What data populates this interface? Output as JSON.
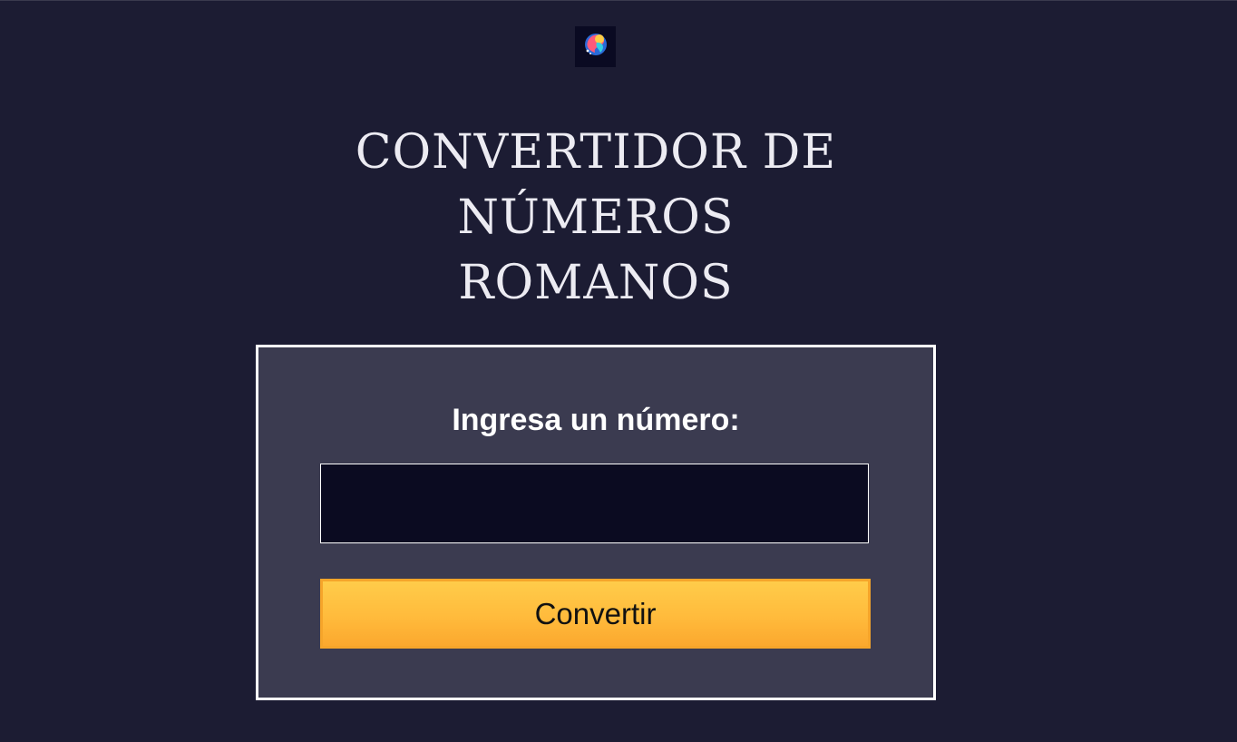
{
  "header": {
    "logo_icon": "swirl-logo-icon"
  },
  "page": {
    "title_line1": "CONVERTIDOR DE",
    "title_line2": "NÚMEROS",
    "title_line3": "ROMANOS"
  },
  "form": {
    "label": "Ingresa un número:",
    "input_value": "",
    "input_placeholder": "",
    "button_label": "Convertir"
  },
  "colors": {
    "background": "#1c1c33",
    "card": "#3b3b50",
    "input": "#0b0b21",
    "button": "#ffbb3c",
    "text": "#ecebf2"
  }
}
